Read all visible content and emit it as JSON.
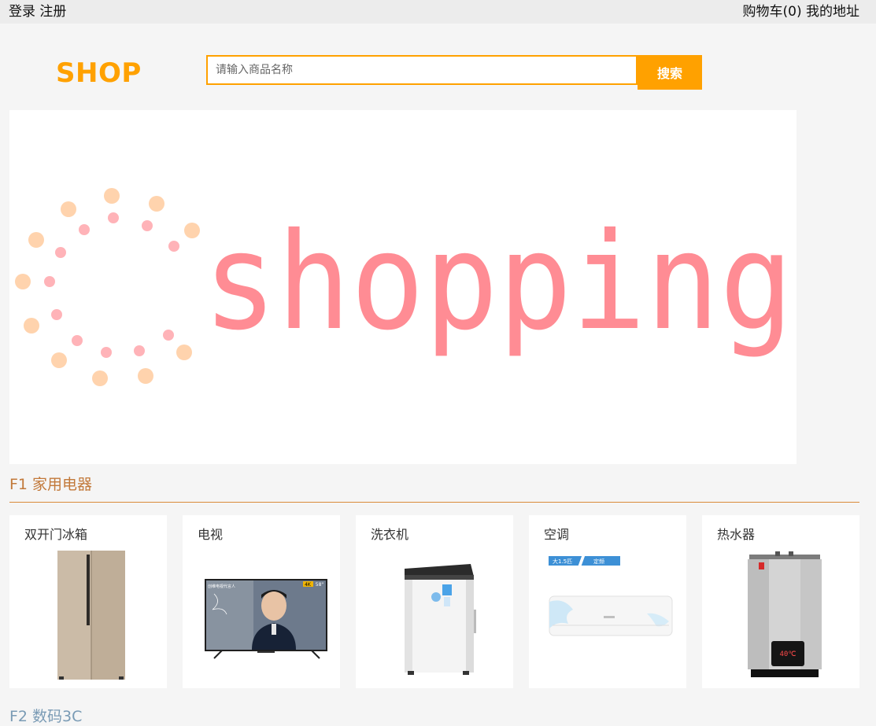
{
  "topbar": {
    "login": "登录",
    "register": "注册",
    "cart": "购物车(0)",
    "address": "我的地址"
  },
  "header": {
    "logo": "SHOP",
    "search_placeholder": "请输入商品名称",
    "search_button": "搜索"
  },
  "banner": {
    "text": "shopping"
  },
  "section1": {
    "title": "F1 家用电器",
    "products": [
      {
        "name": "双开门冰箱",
        "icon": "fridge-image"
      },
      {
        "name": "电视",
        "icon": "tv-image",
        "badge_res": "4K",
        "badge_size": "58\"",
        "screen_caption": "创维电视代言人"
      },
      {
        "name": "洗衣机",
        "icon": "washing-machine-image"
      },
      {
        "name": "空调",
        "icon": "air-conditioner-image",
        "tag1": "大1.5匹",
        "tag2": "定频"
      },
      {
        "name": "热水器",
        "icon": "water-heater-image",
        "display": "40℃"
      }
    ]
  },
  "section2": {
    "title": "F2 数码3C"
  },
  "colors": {
    "accent": "#ffa100",
    "section_title": "#c2793a",
    "banner_text": "#ff8c94",
    "banner_dots_outer": "#ffd3ad",
    "banner_dots_inner": "#ffb3b8"
  }
}
